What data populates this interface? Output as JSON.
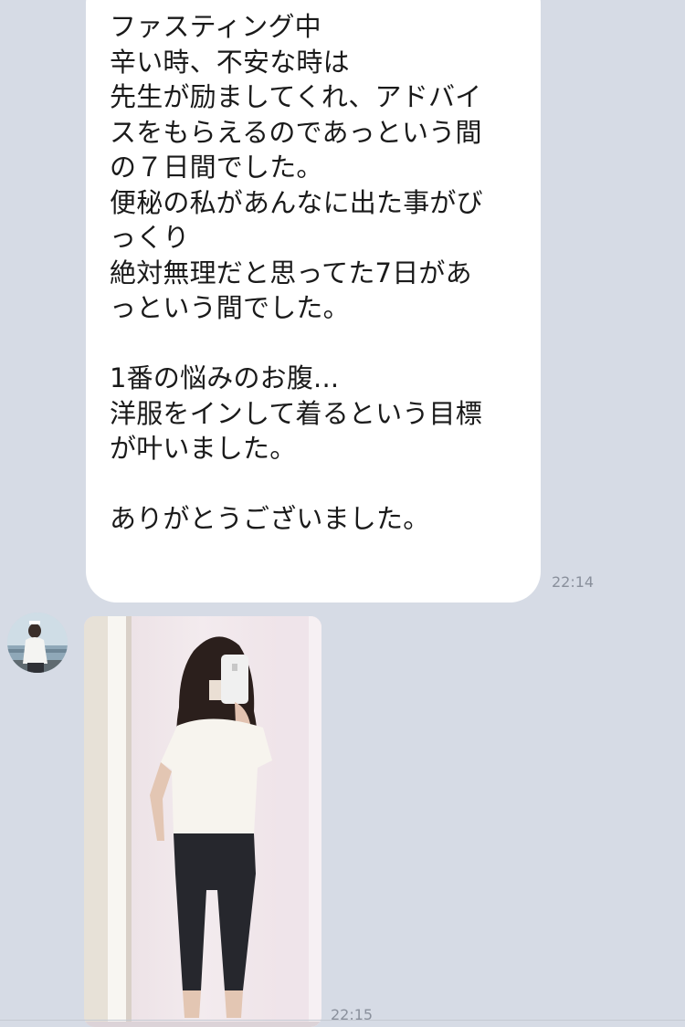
{
  "conversation": {
    "messages": [
      {
        "type": "text",
        "lines": [
          "ファスティング中",
          "辛い時、不安な時は",
          "先生が励ましてくれ、アドバイ",
          "スをもらえるのであっという間",
          "の７日間でした。",
          "便秘の私があんなに出た事がび",
          "っくり",
          "絶対無理だと思ってた7日があ",
          "っという間でした。",
          "",
          "1番の悩みのお腹...",
          "洋服をインして着るという目標",
          "が叶いました。",
          "",
          "ありがとうございました。"
        ],
        "time": "22:14"
      },
      {
        "type": "image",
        "time": "22:15"
      }
    ]
  },
  "colors": {
    "chat_background": "#d6dbe5",
    "bubble": "#ffffff",
    "text": "#1a1a1a",
    "timestamp": "#8a909c"
  }
}
